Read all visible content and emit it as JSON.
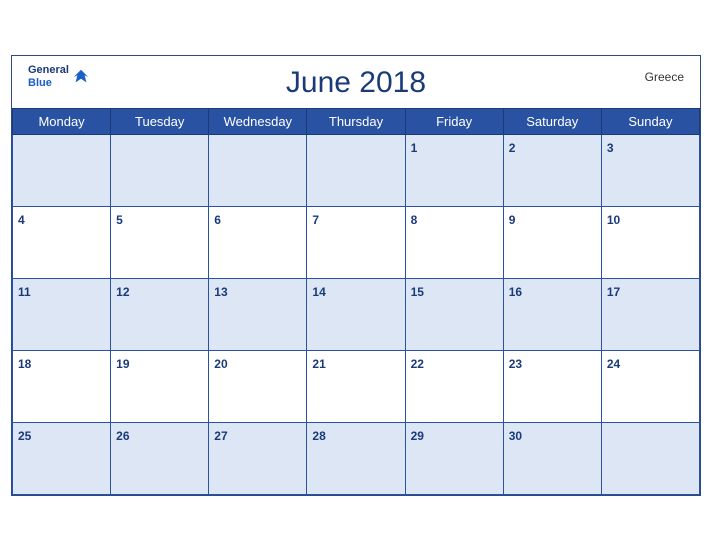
{
  "calendar": {
    "title": "June 2018",
    "country": "Greece",
    "logo": {
      "line1": "General",
      "line2": "Blue"
    },
    "days_of_week": [
      "Monday",
      "Tuesday",
      "Wednesday",
      "Thursday",
      "Friday",
      "Saturday",
      "Sunday"
    ],
    "weeks": [
      [
        null,
        null,
        null,
        null,
        1,
        2,
        3
      ],
      [
        4,
        5,
        6,
        7,
        8,
        9,
        10
      ],
      [
        11,
        12,
        13,
        14,
        15,
        16,
        17
      ],
      [
        18,
        19,
        20,
        21,
        22,
        23,
        24
      ],
      [
        25,
        26,
        27,
        28,
        29,
        30,
        null
      ]
    ]
  }
}
